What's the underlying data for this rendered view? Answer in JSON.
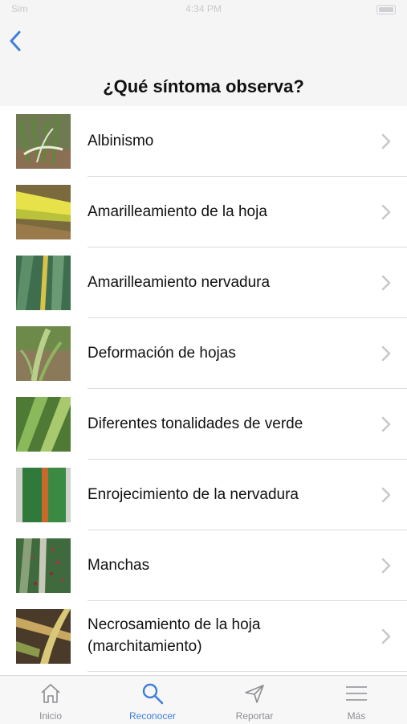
{
  "status": {
    "carrier": "Sim",
    "time": "4:34 PM"
  },
  "header": {
    "title": "¿Qué síntoma observa?"
  },
  "symptoms": [
    {
      "label": "Albinismo"
    },
    {
      "label": "Amarilleamiento de la hoja"
    },
    {
      "label": "Amarilleamiento nervadura"
    },
    {
      "label": "Deformación de hojas"
    },
    {
      "label": "Diferentes tonalidades de verde"
    },
    {
      "label": "Enrojecimiento de la nervadura"
    },
    {
      "label": "Manchas"
    },
    {
      "label": "Necrosamiento de la hoja (marchitamiento)"
    }
  ],
  "tabs": [
    {
      "label": "Inicio",
      "icon": "home-icon"
    },
    {
      "label": "Reconocer",
      "icon": "search-icon",
      "active": true
    },
    {
      "label": "Reportar",
      "icon": "send-icon"
    },
    {
      "label": "Más",
      "icon": "menu-icon"
    }
  ],
  "colors": {
    "accent": "#3f7fd9",
    "inactive": "#8e8e93"
  }
}
